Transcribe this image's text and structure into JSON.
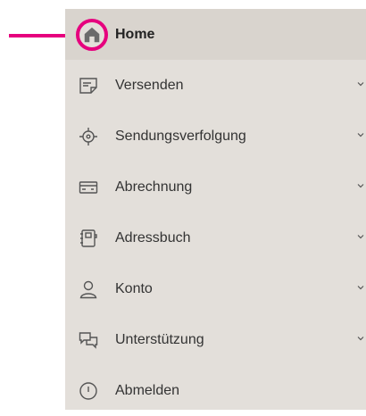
{
  "nav": {
    "items": [
      {
        "label": "Home",
        "icon": "home-icon",
        "active": true
      },
      {
        "label": "Versenden",
        "icon": "shipping-form-icon",
        "expandable": true
      },
      {
        "label": "Sendungsverfolgung",
        "icon": "tracking-target-icon",
        "expandable": true
      },
      {
        "label": "Abrechnung",
        "icon": "billing-card-icon",
        "expandable": true
      },
      {
        "label": "Adressbuch",
        "icon": "address-book-icon",
        "expandable": true
      },
      {
        "label": "Konto",
        "icon": "user-account-icon",
        "expandable": true
      },
      {
        "label": "Unterstützung",
        "icon": "support-chat-icon",
        "expandable": true
      },
      {
        "label": "Abmelden",
        "icon": "power-icon"
      }
    ]
  },
  "colors": {
    "sidebar_bg": "#e3dfda",
    "active_bg": "#d9d4ce",
    "highlight": "#e6007e",
    "text": "#333333"
  }
}
